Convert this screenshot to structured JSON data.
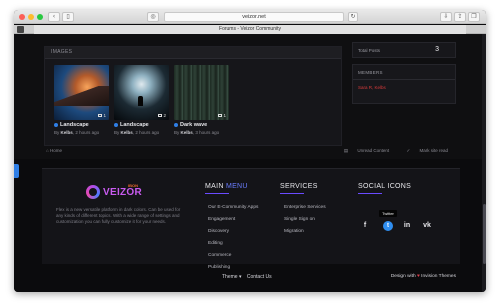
{
  "browser": {
    "address": "veizor.net",
    "tab_title": "Forums - Veizor Community"
  },
  "images_panel": {
    "header": "IMAGES",
    "items": [
      {
        "title": "Landscape",
        "by_prefix": "By",
        "author": "Kelbs",
        "time": "2 hours ago",
        "count": "1"
      },
      {
        "title": "Landscape",
        "by_prefix": "By",
        "author": "Kelbs",
        "time": "2 hours ago",
        "count": "2"
      },
      {
        "title": "Dark wave",
        "by_prefix": "By",
        "author": "Kelbs",
        "time": "3 hours ago",
        "count": "1"
      }
    ]
  },
  "stats": {
    "label": "Total Posts",
    "value": "3"
  },
  "members": {
    "header": "MEMBERS",
    "list": "Sara R, Kelbs"
  },
  "breadcrumb": {
    "home": "Home"
  },
  "actions": {
    "unread": "Unread Content",
    "mark_read": "Mark site read"
  },
  "footer": {
    "logo_text": "VEIZOR",
    "logo_sub": "IBON",
    "about": "Flex is a new versatile platform in dark colors. Can be used for any kinds of different topics. With a wide range of settings and customization you can fully customize it for your needs.",
    "main_menu": {
      "title_part1": "MAIN",
      "title_part2": "MENU",
      "links": [
        "Our E-Community Apps",
        "Engagement",
        "Discovery",
        "Editing",
        "Commerce",
        "Publishing"
      ]
    },
    "services": {
      "title": "SERVICES",
      "links": [
        "Enterprise Services",
        "Single Sign on",
        "Migration"
      ]
    },
    "social": {
      "title": "SOCIAL ICONS",
      "tooltip": "Twitter",
      "icons": [
        "facebook-icon",
        "twitter-icon",
        "linkedin-icon",
        "vk-icon"
      ]
    }
  },
  "bottom": {
    "theme": "Theme ▾",
    "contact": "Contact Us",
    "design_prefix": "Design with",
    "design_suffix": "Invision Themes"
  }
}
